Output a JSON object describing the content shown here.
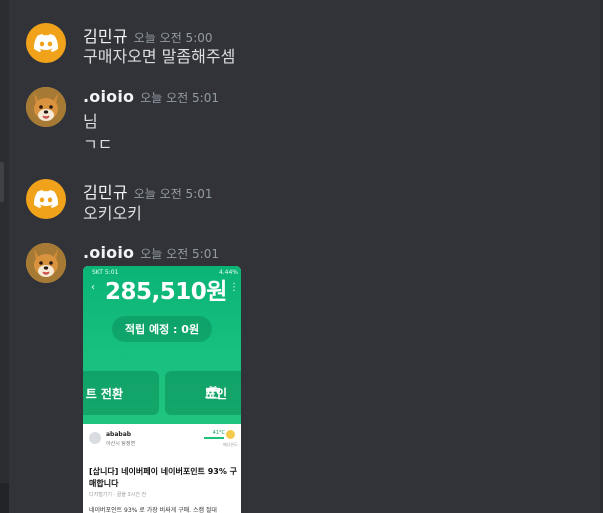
{
  "messages": [
    {
      "username": "김민규",
      "timestamp": "오늘 오전 5:00",
      "lines": [
        "구매자오면 말좀해주셈"
      ],
      "avatar": "discord-logo-icon"
    },
    {
      "username": ".oioio",
      "timestamp": "오늘 오전 5:01",
      "lines": [
        "님",
        "ㄱㄷ"
      ],
      "avatar": "shiba-dog-avatar"
    },
    {
      "username": "김민규",
      "timestamp": "오늘 오전 5:01",
      "lines": [
        "오키오키"
      ],
      "avatar": "discord-logo-icon"
    },
    {
      "username": ".oioio",
      "timestamp": "오늘 오전 5:01",
      "lines": [],
      "avatar": "shiba-dog-avatar"
    }
  ],
  "attachment": {
    "status_left": "SKT 5:01",
    "status_right": "4.44%",
    "amount": "285,510원",
    "pill": "적립 예정 : 0원",
    "button_left": "트 전환",
    "button_right": "포인",
    "card": {
      "user": "ababab",
      "location": "아산시 탕정면",
      "temperature": "41°C",
      "temp_label": "매너온도",
      "title": "[삽니다] 네이버페이 네이버포인트 93% 구매합니다",
      "meta": "디지털기기 · 끌올 3시간 전",
      "desc": "네이버포인트 93% 로 가장 비싸게 구매. 스캠 절대"
    }
  },
  "colors": {
    "background": "#313338",
    "discord_avatar": "#f0a21a",
    "green": "#18c07e"
  }
}
